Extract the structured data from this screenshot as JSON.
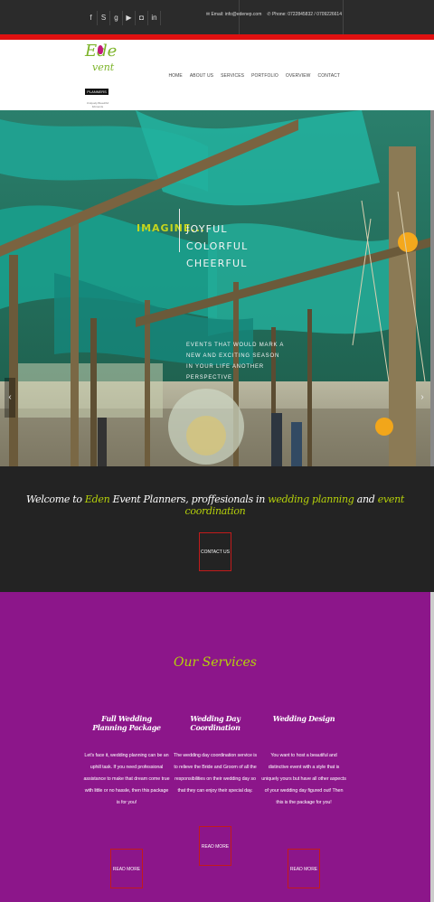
{
  "topbar": {
    "social_icons": [
      "facebook-icon",
      "skype-icon",
      "google-plus-icon",
      "youtube-icon",
      "instagram-icon",
      "linkedin-icon"
    ],
    "social_glyphs": [
      "f",
      "S",
      "g",
      "▶",
      "◘",
      "in"
    ],
    "email": "Email: info@edenep.com",
    "phone": "Phone: 0722845832 / 0709226614"
  },
  "logo": {
    "line1": "Ede",
    "line2": "vent",
    "planners": "PLANNERS",
    "tagline": "Uniquely Beautiful Moments"
  },
  "nav": [
    "HOME",
    "ABOUT US",
    "SERVICES",
    "PORTFOLIO",
    "OVERVIEW",
    "CONTACT"
  ],
  "hero": {
    "imagine": "IMAGINE...",
    "words": [
      "JOYFUL",
      "COLORFUL",
      "CHEERFUL"
    ],
    "description": "EVENTS THAT WOULD MARK A NEW AND EXCITING SEASON IN YOUR LIFE ANOTHER PERSPECTIVE",
    "prev": "‹",
    "next": "›"
  },
  "welcome": {
    "pre": "Welcome to ",
    "brand": "Eden",
    "mid": " Event Planners, proffesionals in ",
    "hl1": "wedding planning",
    "and": " and ",
    "hl2": "event coordination",
    "button": "CONTACT US"
  },
  "services": {
    "title": "Our Services",
    "items": [
      {
        "title": "Full Wedding Planning Package",
        "text": "Let's face it, wedding planning can be an uphill task. If you need professional assistance to make that dream come true with little or no hassle, then this package is for you!",
        "button": "READ MORE"
      },
      {
        "title": "Wedding Day Coordination",
        "text": "The wedding day coordination service is to relieve the Bride and Groom of all the responsibilities on their wedding day so that they can enjoy their special day.",
        "button": "READ MORE"
      },
      {
        "title": "Wedding Design",
        "text": "You want to host a beautiful and distinctive event with a style that is uniquely yours but have all other aspects of your wedding day figured out! Then this is the package for you!",
        "button": "READ MORE"
      }
    ]
  },
  "colors": {
    "accent_red": "#e01010",
    "lime": "#b6d10a",
    "purple": "#8c168a",
    "dark": "#232323"
  }
}
